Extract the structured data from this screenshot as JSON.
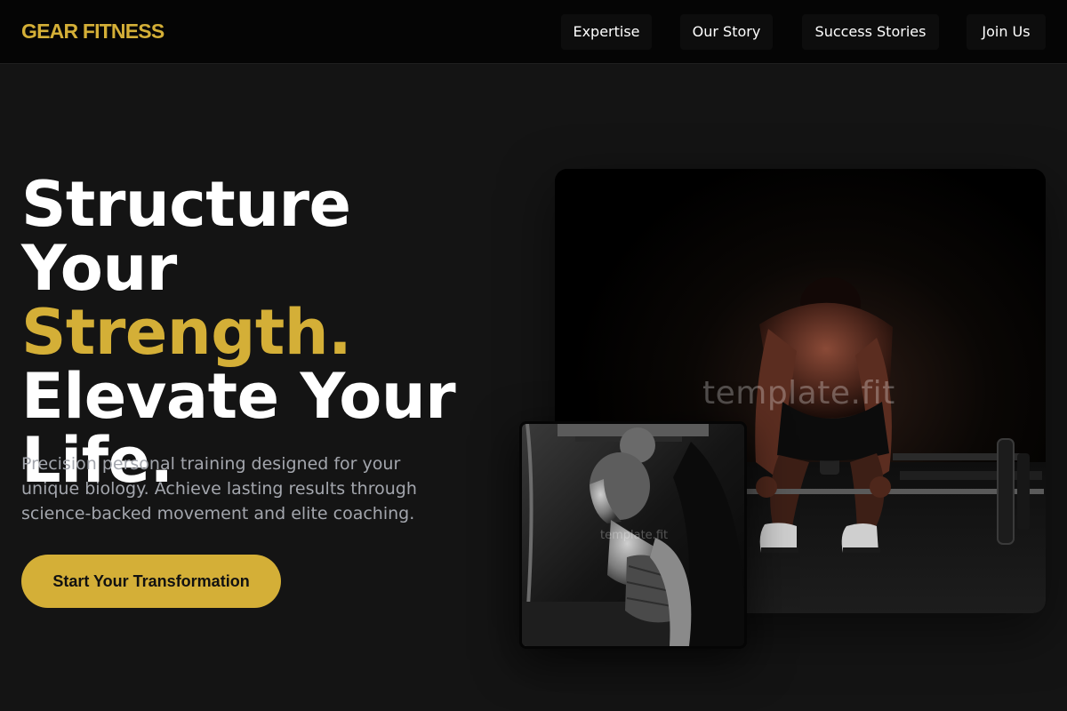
{
  "brand": {
    "name": "GEAR FITNESS"
  },
  "nav": {
    "items": [
      {
        "label": "Expertise"
      },
      {
        "label": "Our Story"
      },
      {
        "label": "Success Stories"
      },
      {
        "label": "Join Us"
      }
    ]
  },
  "hero": {
    "title_line1": "Structure Your",
    "title_line2": "Strength.",
    "title_line3": "Elevate Your",
    "title_line4": "Life.",
    "subtitle": "Precision personal training designed for your unique biology. Achieve lasting results through science-backed movement and elite coaching.",
    "cta_label": "Start Your Transformation"
  },
  "images": {
    "main_watermark": "template.fit",
    "secondary_watermark": "template.fit"
  },
  "colors": {
    "accent": "#d4af37",
    "background": "#141414",
    "navbar": "#050505",
    "text_muted": "#a3a6ad"
  }
}
